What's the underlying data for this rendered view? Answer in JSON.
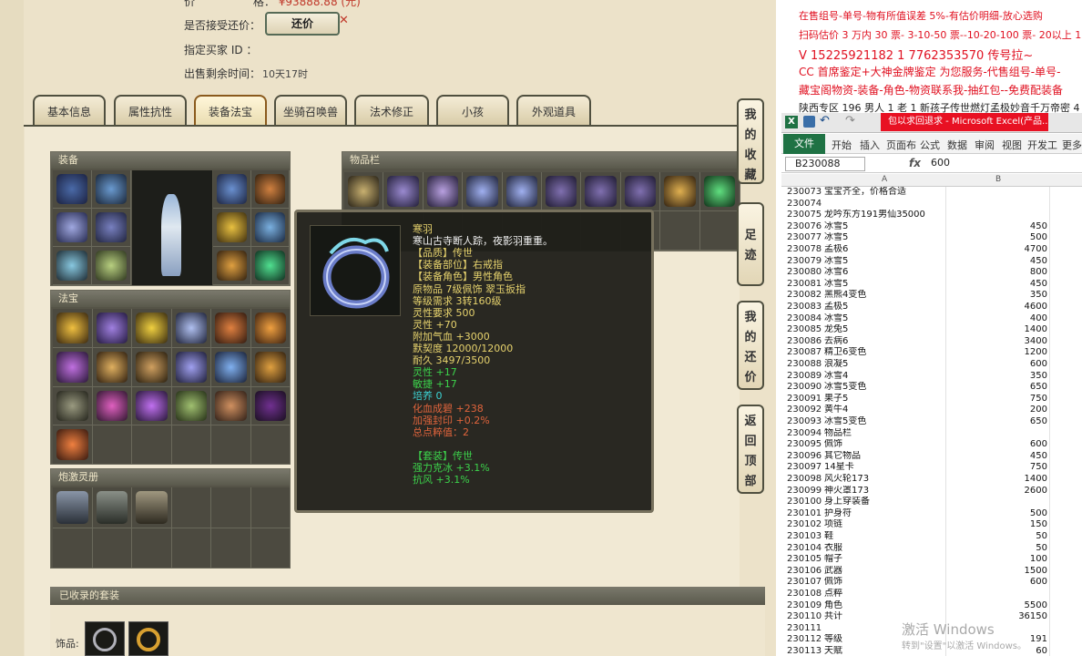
{
  "listing": {
    "price_label": "价",
    "price_tail": "格：",
    "price_value": "¥93888.88 (元)",
    "accept_counter_label": "是否接受还价：",
    "counter_button": "还价",
    "buyer_id_label": "指定买家 ID ：",
    "time_left_label": "出售剩余时间：",
    "time_left_value": "10天17时"
  },
  "tabs": [
    "基本信息",
    "属性抗性",
    "装备法宝",
    "坐骑召唤兽",
    "法术修正",
    "小孩",
    "外观道具"
  ],
  "active_tab": "装备法宝",
  "side_buttons": [
    "我的收藏",
    "足迹",
    "我的还价",
    "返回顶部"
  ],
  "panels": {
    "equipment": "装备",
    "inventory": "物品栏",
    "treasure": "法宝",
    "spirit": "炮激灵册",
    "suits": "已收录的套装",
    "suit_row_label": "饰品:"
  },
  "tooltip": {
    "lines": [
      {
        "text": "寒羽",
        "color": "#e7d36d"
      },
      {
        "text": "寒山古寺断人踪，夜影羽重重。",
        "color": "#f0f0f0"
      },
      {
        "text": "【品质】传世",
        "color": "#e7d36d"
      },
      {
        "text": "【装备部位】右戒指",
        "color": "#e7d36d"
      },
      {
        "text": "【装备角色】男性角色",
        "color": "#e7d36d"
      },
      {
        "text": "原物品 7级佩饰 翠玉扳指",
        "color": "#e7d36d"
      },
      {
        "text": "等级需求 3转160级",
        "color": "#e7d36d"
      },
      {
        "text": "灵性要求 500",
        "color": "#e7d36d"
      },
      {
        "text": "灵性 +70",
        "color": "#e7d36d"
      },
      {
        "text": "附加气血 +3000",
        "color": "#e7d36d"
      },
      {
        "text": "默契度 12000/12000",
        "color": "#e7d36d"
      },
      {
        "text": "耐久 3497/3500",
        "color": "#e7d36d"
      },
      {
        "text": "灵性 +17",
        "color": "#3cd24b"
      },
      {
        "text": "敏捷 +17",
        "color": "#3cd24b"
      },
      {
        "text": "培养 0",
        "color": "#3cd2d2"
      },
      {
        "text": "化血成碧 +238",
        "color": "#e0643c"
      },
      {
        "text": "加强封印 +0.2%",
        "color": "#e0643c"
      },
      {
        "text": "总点粹值：2",
        "color": "#e0643c"
      },
      {
        "text": "",
        "color": "#e7d36d"
      },
      {
        "text": "【套装】传世",
        "color": "#3cd24b"
      },
      {
        "text": "强力克冰 +3.1%",
        "color": "#3cd24b"
      },
      {
        "text": "抗风 +3.1%",
        "color": "#3cd24b"
      }
    ]
  },
  "ad_lines": [
    "在售组号-单号-物有所值误差 5%-有估价明细-放心选购",
    "扫码估价 3 万内 30 票- 3-10-50 票--10-20-100 票- 20以上 150-",
    "V 15225921182   1 7762353570   传号拉~",
    "CC 首席鉴定+大神金牌鉴定 为您服务-代售组号-单号-",
    "藏宝阁物资-装备-角色-物资联系我-抽红包--免费配装备",
    "陕西专区 196 男人 1 老 1 新孩子传世燃灯孟极妙音千万帝密 4"
  ],
  "excel": {
    "title": "包以求回退求 - Microsoft Excel(产品...",
    "file_tab": "文件",
    "ribbon_tabs": [
      "开始",
      "插入",
      "页面布",
      "公式",
      "数据",
      "审阅",
      "视图",
      "开发工",
      "更多"
    ],
    "name_box": "B230088",
    "formula_value": "600",
    "fx": "fx",
    "col_a": "A",
    "col_b": "B",
    "rows": [
      {
        "n": "230073",
        "a": "宝宝齐全，价格合适",
        "b": ""
      },
      {
        "n": "230074",
        "a": "",
        "b": ""
      },
      {
        "n": "230075",
        "a": "龙吟东方191男仙35000",
        "b": ""
      },
      {
        "n": "230076",
        "a": "冰雪5",
        "b": "450"
      },
      {
        "n": "230077",
        "a": "冰雪5",
        "b": "500"
      },
      {
        "n": "230078",
        "a": "孟极6",
        "b": "4700"
      },
      {
        "n": "230079",
        "a": "冰雪5",
        "b": "450"
      },
      {
        "n": "230080",
        "a": "冰雪6",
        "b": "800"
      },
      {
        "n": "230081",
        "a": "冰雪5",
        "b": "450"
      },
      {
        "n": "230082",
        "a": "黑熊4变色",
        "b": "350"
      },
      {
        "n": "230083",
        "a": "孟极5",
        "b": "4600"
      },
      {
        "n": "230084",
        "a": "冰雪5",
        "b": "400"
      },
      {
        "n": "230085",
        "a": "龙兔5",
        "b": "1400"
      },
      {
        "n": "230086",
        "a": "去病6",
        "b": "3400"
      },
      {
        "n": "230087",
        "a": "精卫6变色",
        "b": "1200"
      },
      {
        "n": "230088",
        "a": "浪凝5",
        "b": "600"
      },
      {
        "n": "230089",
        "a": "冰雪4",
        "b": "350"
      },
      {
        "n": "230090",
        "a": "冰雪5变色",
        "b": "650"
      },
      {
        "n": "230091",
        "a": "果子5",
        "b": "750"
      },
      {
        "n": "230092",
        "a": "黄牛4",
        "b": "200"
      },
      {
        "n": "230093",
        "a": "冰雪5变色",
        "b": "650"
      },
      {
        "n": "230094",
        "a": "物品栏",
        "b": ""
      },
      {
        "n": "230095",
        "a": "佩饰",
        "b": "600"
      },
      {
        "n": "230096",
        "a": "其它物品",
        "b": "450"
      },
      {
        "n": "230097",
        "a": "14星卡",
        "b": "750"
      },
      {
        "n": "230098",
        "a": "风火轮173",
        "b": "1400"
      },
      {
        "n": "230099",
        "a": "神火罩173",
        "b": "2600"
      },
      {
        "n": "230100",
        "a": "身上穿装备",
        "b": ""
      },
      {
        "n": "230101",
        "a": "护身符",
        "b": "500"
      },
      {
        "n": "230102",
        "a": "项链",
        "b": "150"
      },
      {
        "n": "230103",
        "a": "鞋",
        "b": "50"
      },
      {
        "n": "230104",
        "a": "衣服",
        "b": "50"
      },
      {
        "n": "230105",
        "a": "帽子",
        "b": "100"
      },
      {
        "n": "230106",
        "a": "武器",
        "b": "1500"
      },
      {
        "n": "230107",
        "a": "佩饰",
        "b": "600"
      },
      {
        "n": "230108",
        "a": "点粹",
        "b": ""
      },
      {
        "n": "230109",
        "a": "角色",
        "b": "5500"
      },
      {
        "n": "230110",
        "a": "共计",
        "b": "36150"
      },
      {
        "n": "230111",
        "a": "",
        "b": ""
      },
      {
        "n": "230112",
        "a": "等级",
        "b": "191"
      },
      {
        "n": "230113",
        "a": "天赋",
        "b": "60"
      }
    ]
  },
  "watermark": {
    "line1": "激活 Windows",
    "line2": "转到\"设置\"以激活 Windows。"
  }
}
